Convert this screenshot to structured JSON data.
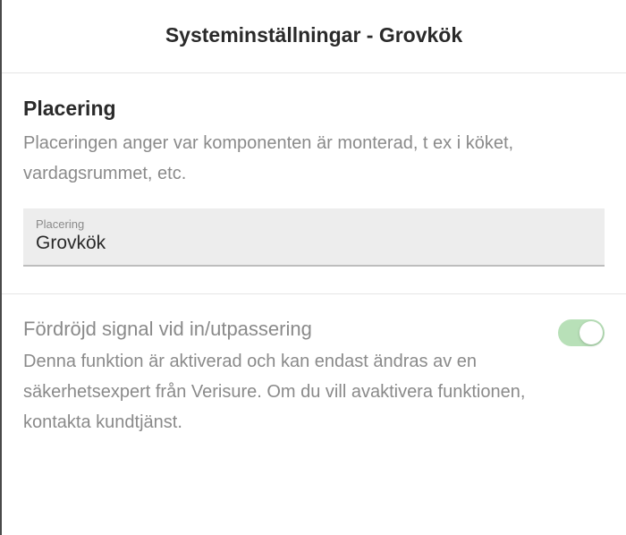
{
  "header": {
    "title": "Systeminställningar - Grovkök"
  },
  "placement": {
    "title": "Placering",
    "description": "Placeringen anger var komponenten är monterad, t ex i köket, vardagsrummet, etc.",
    "input_label": "Placering",
    "input_value": "Grovkök"
  },
  "delay": {
    "title": "Fördröjd signal vid in/utpassering",
    "description": "Denna funktion är aktiverad och kan endast ändras av en säkerhetsexpert från Verisure. Om du vill avaktivera funktionen, kontakta kundtjänst.",
    "toggle_on": true
  }
}
